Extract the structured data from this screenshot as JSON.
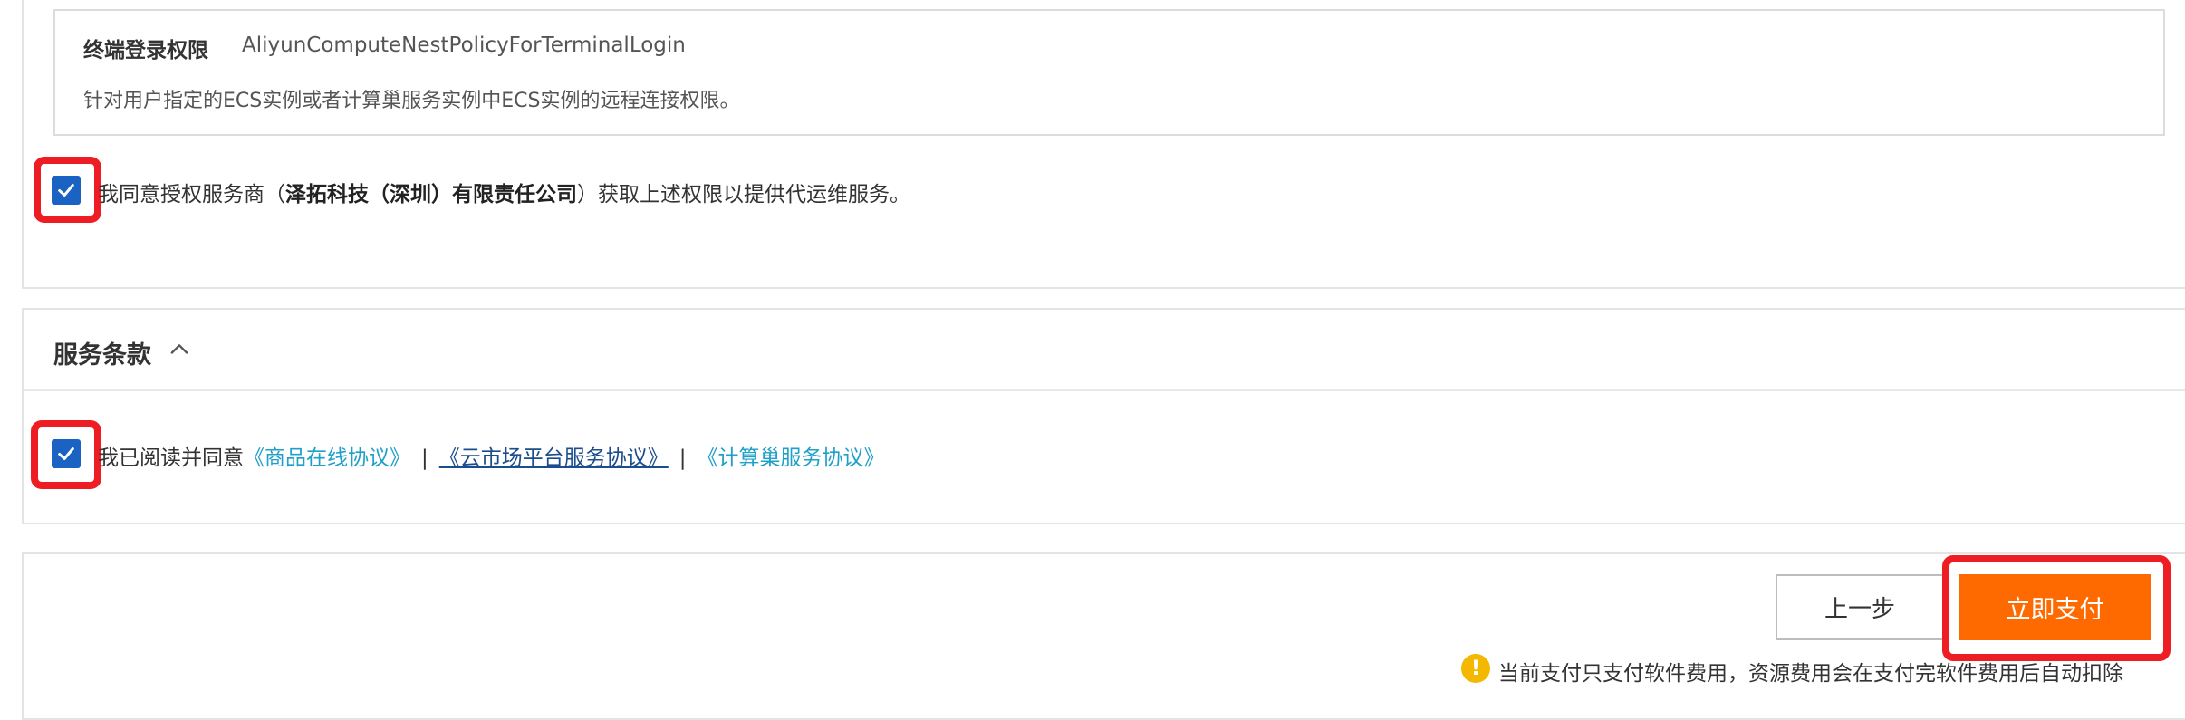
{
  "permission": {
    "title": "终端登录权限",
    "policy_name": "AliyunComputeNestPolicyForTerminalLogin",
    "description": "针对用户指定的ECS实例或者计算巢服务实例中ECS实例的远程连接权限。",
    "agree_prefix": "我同意授权服务商（",
    "provider_name": "泽拓科技（深圳）有限责任公司",
    "agree_suffix": "）获取上述权限以提供代运维服务。",
    "agree_checked": true
  },
  "terms": {
    "title": "服务条款",
    "expanded": true,
    "agree_prefix": "我已阅读并同意",
    "links": [
      "《商品在线协议》",
      "《云市场平台服务协议》",
      "《计算巢服务协议》"
    ],
    "separator": "|",
    "agree_checked": true
  },
  "footer": {
    "prev_label": "上一步",
    "pay_label": "立即支付",
    "notice": "当前支付只支付软件费用，资源费用会在支付完软件费用后自动扣除",
    "warning_icon_glyph": "!"
  },
  "colors": {
    "checkbox": "#1a63c2",
    "pay_button": "#ff6a00",
    "highlight_box": "#ee1d23",
    "link": "#1fa0c8",
    "warning": "#f5b800"
  },
  "icons": {
    "checkbox": "check-icon",
    "collapse": "chevron-up-icon",
    "warning": "warning-icon"
  }
}
